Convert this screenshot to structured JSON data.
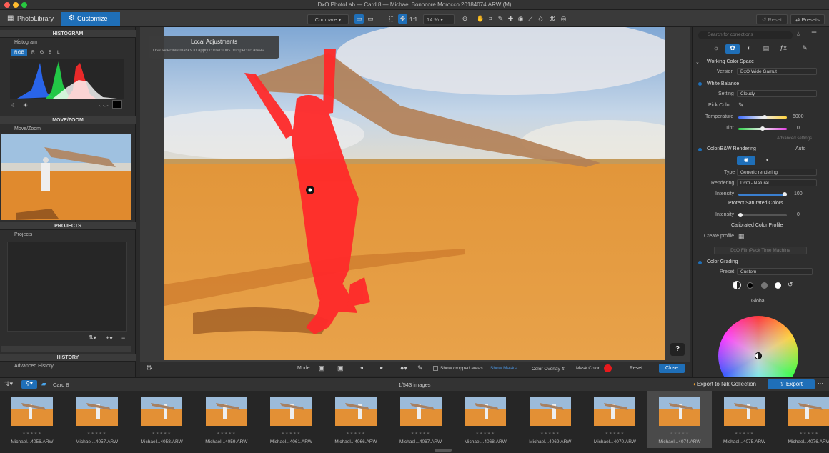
{
  "window": {
    "title": "DxO PhotoLab — Card 8 — Michael Bonocore Morocco 20184074.ARW (M)"
  },
  "toolbar": {
    "tab_library": "PhotoLibrary",
    "tab_customize": "Customize",
    "compare": "Compare",
    "zoom_one": "1:1",
    "zoom_level": "14 %",
    "reset": "Reset",
    "presets": "Presets"
  },
  "left": {
    "histogram_header": "HISTOGRAM",
    "histogram_sub": "Histogram",
    "channels": [
      "RGB",
      "R",
      "G",
      "B",
      "L"
    ],
    "histogram_readout": "-, -, -",
    "movezoom_header": "MOVE/ZOOM",
    "movezoom_sub": "Move/Zoom",
    "projects_header": "PROJECTS",
    "projects_sub": "Projects",
    "history_header": "HISTORY",
    "history_sub": "Advanced History"
  },
  "viewer": {
    "tooltip_title": "Local Adjustments",
    "tooltip_text": "Use selective masks to apply corrections on specific areas",
    "help": "?"
  },
  "viewer_bar": {
    "mode": "Mode",
    "show_cropped": "Show cropped areas",
    "show_masks": "Show Masks",
    "color_overlay": "Color Overlay",
    "mask_color": "Mask Color",
    "mask_color_hex": "#e8191c",
    "reset": "Reset",
    "close": "Close"
  },
  "right": {
    "search_placeholder": "Search for corrections",
    "working_color_space": "Working Color Space",
    "version_label": "Version",
    "version_value": "DxO Wide Gamut",
    "white_balance": "White Balance",
    "setting_label": "Setting",
    "setting_value": "Cloudy",
    "pick_color": "Pick Color",
    "temperature_label": "Temperature",
    "temperature_value": "6000",
    "tint_label": "Tint",
    "tint_value": "0",
    "advanced_settings": "Advanced settings",
    "color_rendering": "Color/B&W Rendering",
    "auto": "Auto",
    "type_label": "Type",
    "type_value": "Generic rendering",
    "rendering_label": "Rendering",
    "rendering_value": "DxO - Natural",
    "intensity_label": "Intensity",
    "intensity_value": "100",
    "protect_saturated": "Protect Saturated Colors",
    "protect_intensity_label": "Intensity",
    "protect_intensity_value": "0",
    "calibrated_profile": "Calibrated Color Profile",
    "create_profile": "Create profile",
    "filmpack_time_machine": "DxO FilmPack Time Machine",
    "color_grading": "Color Grading",
    "preset_label": "Preset",
    "preset_value": "Custom",
    "global": "Global"
  },
  "filmbar": {
    "folder": "Card 8",
    "count": "1/543 images",
    "export_nik": "Export to Nik Collection",
    "export": "Export"
  },
  "filmstrip": [
    {
      "name": "Michael...4056.ARW"
    },
    {
      "name": "Michael...4057.ARW"
    },
    {
      "name": "Michael...4058.ARW"
    },
    {
      "name": "Michael...4059.ARW"
    },
    {
      "name": "Michael...4061.ARW"
    },
    {
      "name": "Michael...4066.ARW"
    },
    {
      "name": "Michael...4067.ARW"
    },
    {
      "name": "Michael...4068.ARW"
    },
    {
      "name": "Michael...4069.ARW"
    },
    {
      "name": "Michael...4070.ARW"
    },
    {
      "name": "Michael...4074.ARW",
      "selected": true
    },
    {
      "name": "Michael...4075.ARW"
    },
    {
      "name": "Michael...4076.ARW"
    }
  ],
  "colors": {
    "accent": "#1f6fb8",
    "mask": "#e8191c",
    "sand": "#e89a3c"
  }
}
